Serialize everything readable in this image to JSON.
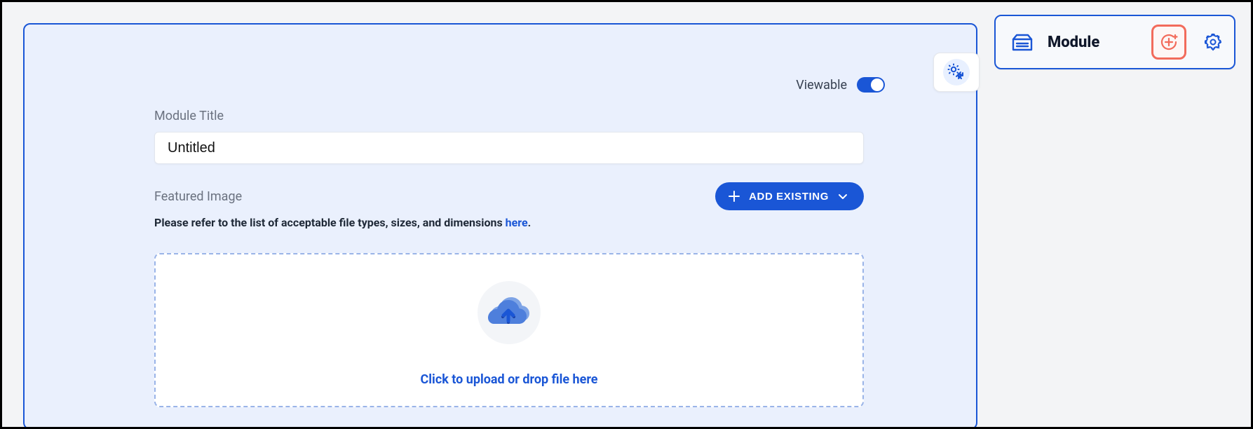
{
  "main": {
    "viewable_label": "Viewable",
    "viewable_on": true,
    "module_title_label": "Module Title",
    "module_title_value": "Untitled",
    "featured_image_label": "Featured Image",
    "add_existing_label": "ADD EXISTING",
    "helper_text_prefix": "Please refer to the list of acceptable file types, sizes, and dimensions ",
    "helper_link_text": "here",
    "helper_text_suffix": ".",
    "dropzone_text": "Click to upload or drop file here"
  },
  "sidebar": {
    "module_label": "Module"
  },
  "icons": {
    "gear_shrink": "gear-collapse-icon",
    "plus": "plus-icon",
    "chevron_down": "chevron-down-icon",
    "cloud_upload": "cloud-upload-icon",
    "module": "module-icon",
    "add_circle": "add-circle-plus-icon",
    "gear": "gear-icon"
  },
  "colors": {
    "primary": "#1a56d6",
    "panel_bg": "#eaf0fd",
    "page_bg": "#f3f4f6",
    "highlight_border": "#f26b5b"
  }
}
